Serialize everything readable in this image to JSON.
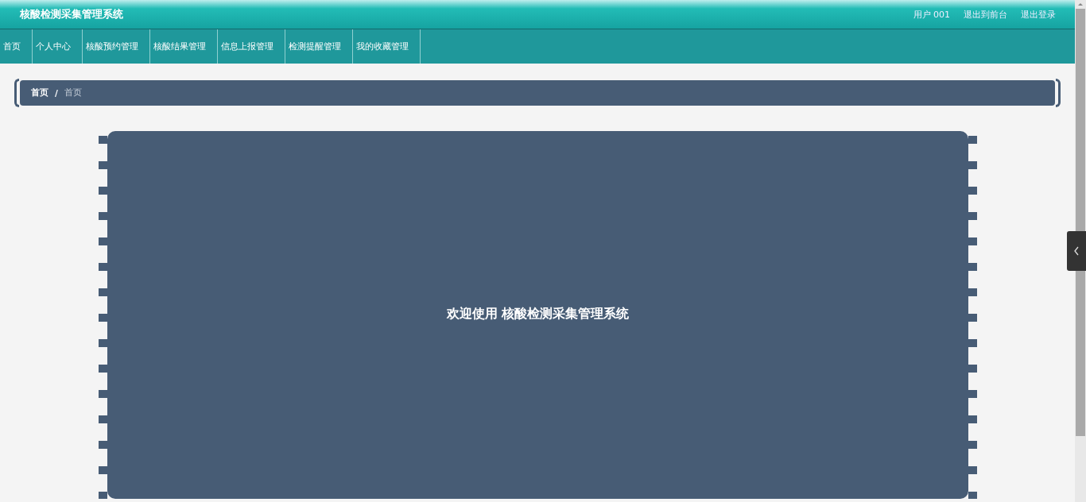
{
  "header": {
    "title": "核酸检测采集管理系统",
    "links": [
      "用户 001",
      "退出到前台",
      "退出登录"
    ]
  },
  "nav": [
    {
      "label": "首页",
      "selected": false
    },
    {
      "label": "个人中心",
      "selected": false
    },
    {
      "label": "核酸预约管理",
      "selected": false
    },
    {
      "label": "核酸结果管理",
      "selected": false
    },
    {
      "label": "信息上报管理",
      "selected": false
    },
    {
      "label": "检测提醒管理",
      "selected": false
    },
    {
      "label": "我的收藏管理",
      "selected": false
    }
  ],
  "breadcrumb": [
    "首页",
    "/",
    "首页"
  ],
  "welcome": "欢迎使用 核酸检测采集管理系统"
}
